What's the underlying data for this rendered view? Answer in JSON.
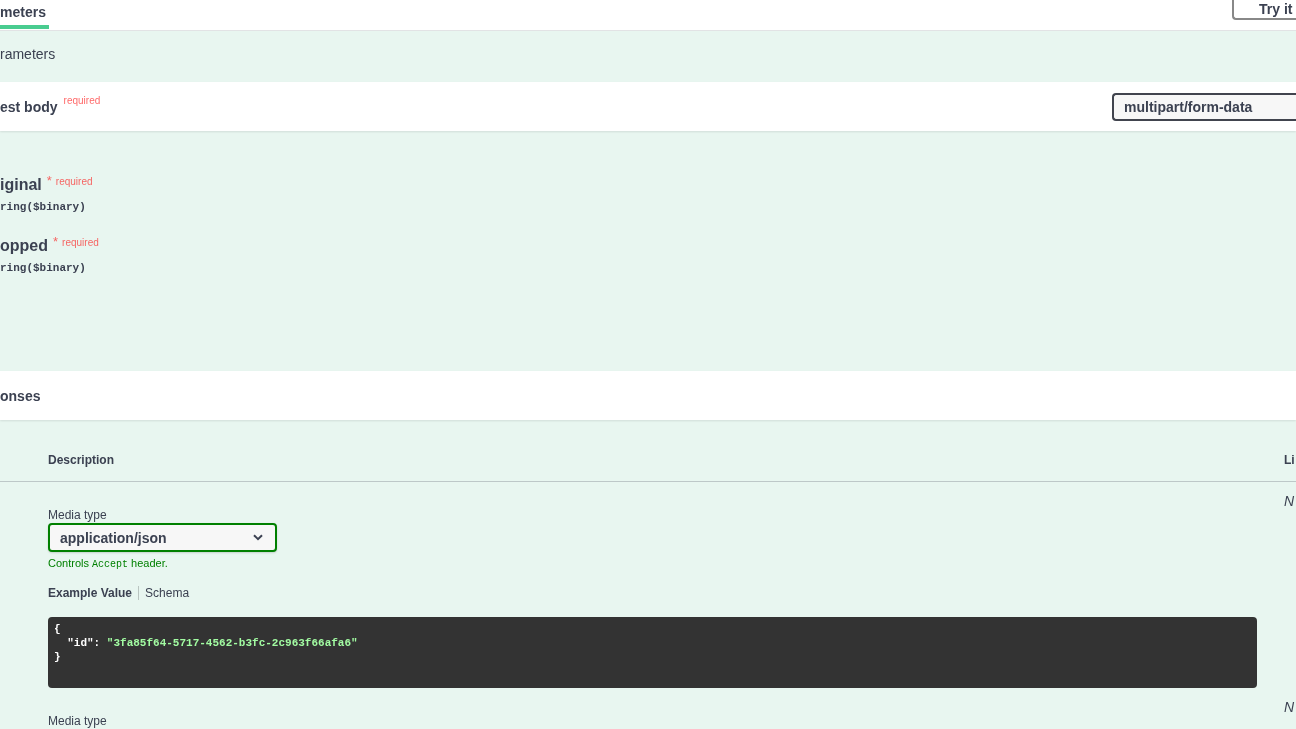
{
  "tabs": [
    {
      "label": "meters",
      "selected": true
    }
  ],
  "try_button": {
    "label": "Try it"
  },
  "parameters_section": {
    "message": "rameters"
  },
  "request_body": {
    "title": "est body",
    "required_label": "required",
    "content_type": "multipart/form-data",
    "fields": [
      {
        "name": "iginal",
        "required_mark": "*",
        "required_label": "required",
        "type": "ring($binary)"
      },
      {
        "name": "opped",
        "required_mark": "*",
        "required_label": "required",
        "type": "ring($binary)"
      }
    ]
  },
  "responses": {
    "title": "onses",
    "columns": [
      "Description",
      "Li"
    ],
    "rows": [
      {
        "media_type_label": "Media type",
        "media_type": "application/json",
        "accept_note": {
          "before": "Controls",
          "code": "Accept",
          "after": "header."
        },
        "example_tabs": [
          {
            "label": "Example Value",
            "selected": true
          },
          {
            "label": "Schema",
            "selected": false
          }
        ],
        "example": {
          "open": "{",
          "key": "\"id\"",
          "colon": ":",
          "value": "\"3fa85f64-5717-4562-b3fc-2c963f66afa6\"",
          "close": "}"
        },
        "links": "N"
      },
      {
        "media_type_label": "Media type",
        "links": "N"
      }
    ]
  }
}
